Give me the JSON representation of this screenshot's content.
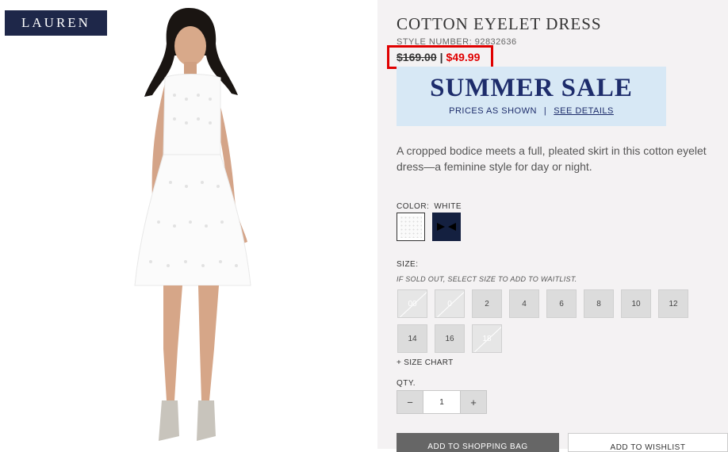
{
  "brand": {
    "logo_text": "LAUREN"
  },
  "product": {
    "title": "COTTON EYELET DRESS",
    "style_label": "STYLE NUMBER:",
    "style_number": "92832636",
    "price_original": "$169.00",
    "price_separator": "|",
    "price_sale": "$49.99",
    "description": "A cropped bodice meets a full, pleated skirt in this cotton eyelet dress—a feminine style for day or night."
  },
  "sale_banner": {
    "title": "SUMMER SALE",
    "subtitle": "PRICES AS SHOWN",
    "separator": "|",
    "link": "SEE DETAILS"
  },
  "color": {
    "label": "COLOR:",
    "selected": "WHITE"
  },
  "size": {
    "label": "SIZE:",
    "note": "IF SOLD OUT, SELECT SIZE TO ADD TO WAITLIST.",
    "options": [
      {
        "label": "00",
        "sold_out": true
      },
      {
        "label": "0",
        "sold_out": true
      },
      {
        "label": "2",
        "sold_out": false
      },
      {
        "label": "4",
        "sold_out": false
      },
      {
        "label": "6",
        "sold_out": false
      },
      {
        "label": "8",
        "sold_out": false
      },
      {
        "label": "10",
        "sold_out": false
      },
      {
        "label": "12",
        "sold_out": false
      },
      {
        "label": "14",
        "sold_out": false
      },
      {
        "label": "16",
        "sold_out": false
      },
      {
        "label": "18",
        "sold_out": true
      }
    ],
    "chart_link": "+ SIZE CHART"
  },
  "quantity": {
    "label": "QTY.",
    "value": "1",
    "minus": "−",
    "plus": "+"
  },
  "actions": {
    "add_to_bag": "ADD TO SHOPPING BAG",
    "add_to_wishlist": "ADD TO WISHLIST"
  },
  "colors": {
    "sale_red": "#e00000",
    "navy": "#1d2c6b",
    "banner_bg": "#d7e8f5",
    "panel_bg": "#f4f2f3"
  }
}
